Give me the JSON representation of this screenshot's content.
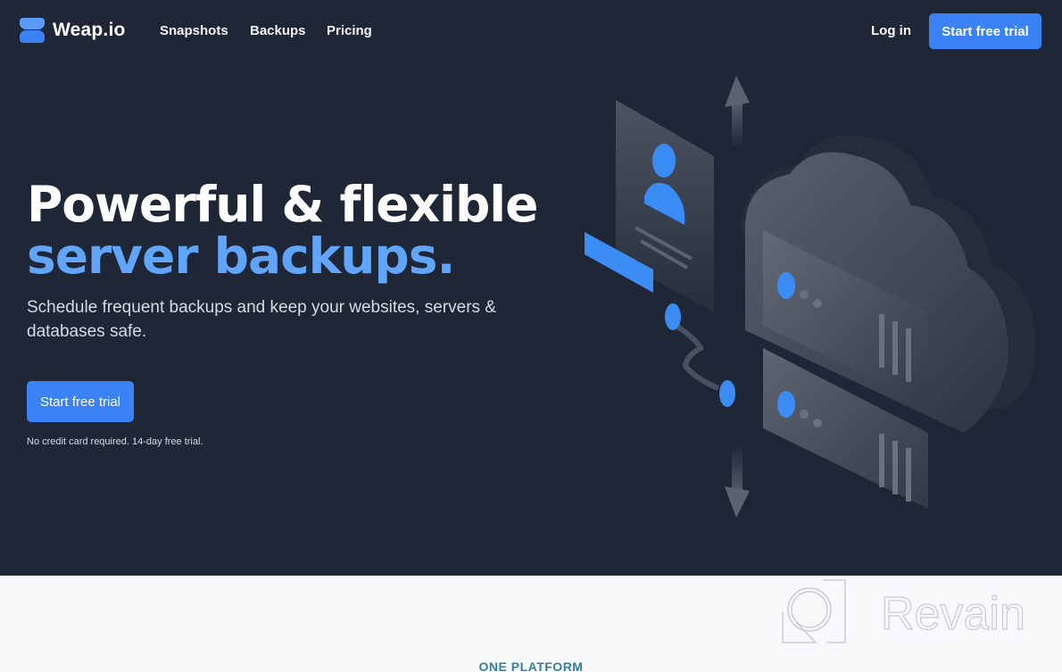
{
  "nav": {
    "brand": "Weap.io",
    "links": [
      {
        "label": "Snapshots"
      },
      {
        "label": "Backups"
      },
      {
        "label": "Pricing"
      }
    ],
    "login_label": "Log in",
    "cta_label": "Start free trial"
  },
  "hero": {
    "headline_line1": "Powerful & flexible",
    "headline_line2": "server backups.",
    "subtitle": "Schedule frequent backups and keep your websites, servers & databases safe.",
    "cta_label": "Start free trial",
    "note": "No credit card required. 14-day free trial.",
    "illustration": "cloud-server-backup-illustration"
  },
  "section": {
    "eyebrow": "ONE PLATFORM"
  },
  "watermark": {
    "text": "Revain"
  },
  "colors": {
    "background": "#1f2636",
    "accent": "#3b82f6",
    "headline_accent": "#60a5fa",
    "eyebrow": "#2f7ea6",
    "lower_bg": "#f7f9fb"
  }
}
